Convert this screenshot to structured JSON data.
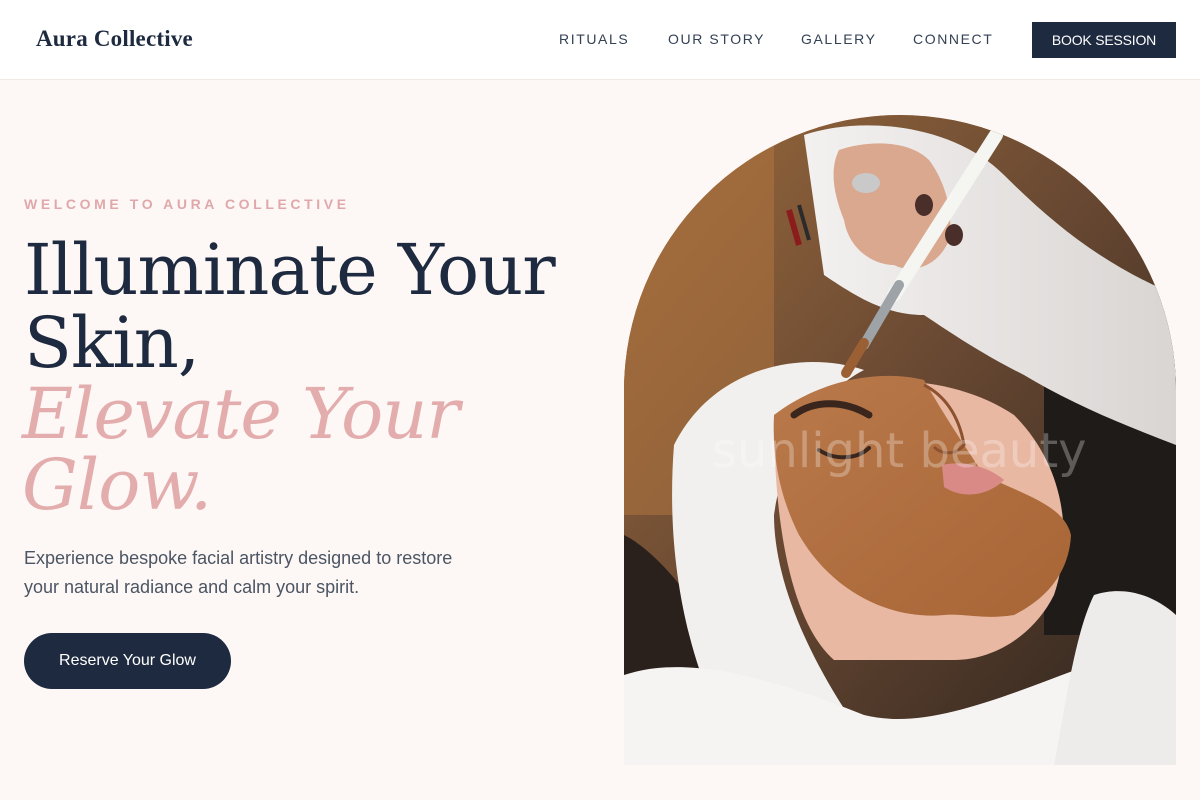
{
  "header": {
    "logo": "Aura Collective",
    "nav": {
      "rituals": "RITUALS",
      "story": "OUR STORY",
      "gallery": "GALLERY",
      "connect": "CONNECT"
    },
    "book_label": "BOOK SESSION"
  },
  "hero": {
    "eyebrow": "WELCOME TO AURA COLLECTIVE",
    "headline_line1": "Illuminate Your",
    "headline_line2": "Skin,",
    "headline_line3": "Elevate Your",
    "headline_line4": "Glow.",
    "subtitle": "Experience bespoke facial artistry designed to restore your natural radiance and calm your spirit.",
    "cta_label": "Reserve Your Glow",
    "image_watermark": "sunlight beauty"
  },
  "colors": {
    "navy": "#1e2a3f",
    "blush": "#e4adad",
    "background": "#fdf8f6"
  }
}
